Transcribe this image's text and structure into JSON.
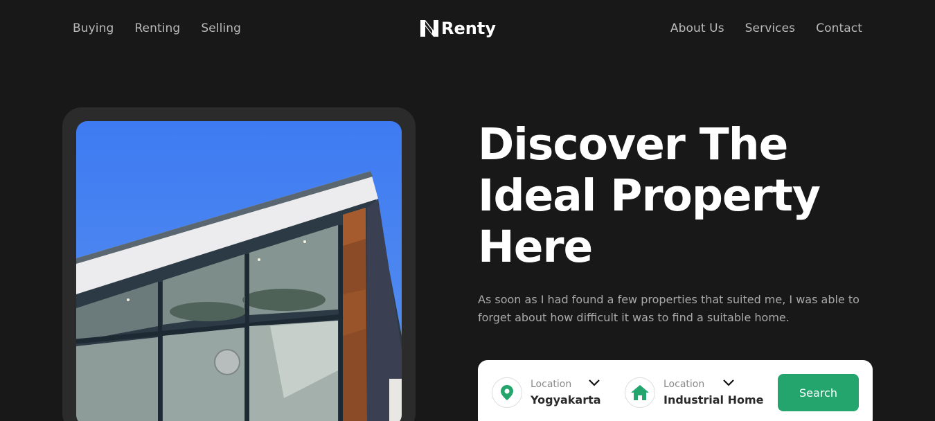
{
  "nav": {
    "left": [
      "Buying",
      "Renting",
      "Selling"
    ],
    "logo_text": "Renty",
    "right": [
      "About Us",
      "Services",
      "Contact"
    ]
  },
  "hero": {
    "title_line1": "Discover The",
    "title_line2": "Ideal Property",
    "title_line3": "Here",
    "subtitle": "As soon as I had found a few properties that suited me, I was able to forget about how difficult it was to find a suitable home."
  },
  "search": {
    "location_label": "Location",
    "location_value": "Yogyakarta",
    "type_label": "Location",
    "type_value": "Industrial Home",
    "button_label": "Search"
  },
  "colors": {
    "background": "#181818",
    "accent": "#23a56d",
    "frame": "#2b2b2b",
    "sky": "#3e7bf2"
  },
  "icons": {
    "location": "location-pin-icon",
    "type": "home-icon",
    "dropdown": "chevron-down-icon"
  }
}
